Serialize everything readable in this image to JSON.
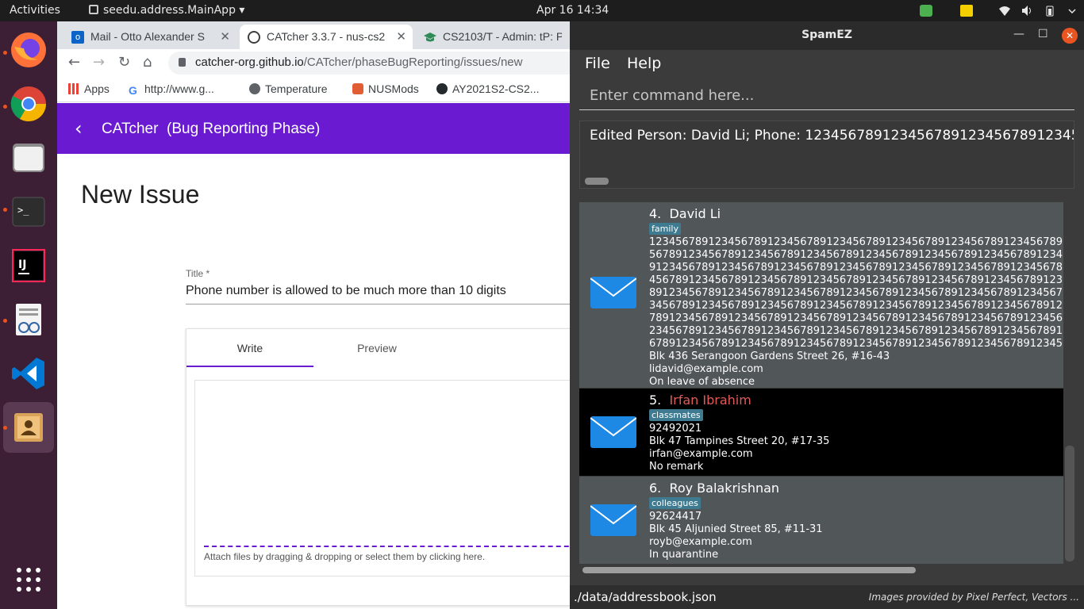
{
  "topbar": {
    "activities": "Activities",
    "app_menu": "seedu.address.MainApp",
    "clock": "Apr 16  14:34"
  },
  "browser": {
    "tabs": [
      {
        "label": "Mail - Otto Alexander S",
        "active": false
      },
      {
        "label": "CATcher 3.3.7 - nus-cs2",
        "active": true
      },
      {
        "label": "CS2103/T - Admin: tP: P",
        "active": false
      }
    ],
    "url_host": "catcher-org.github.io",
    "url_path": "/CATcher/phaseBugReporting/issues/new",
    "bookmarks": [
      "Apps",
      "http://www.g...",
      "Temperature",
      "NUSMods",
      "AY2021S2-CS2..."
    ],
    "app_title": "CATcher  (Bug Reporting Phase)",
    "page_heading": "New Issue",
    "title_label": "Title *",
    "title_value": "Phone number is allowed to be much more than 10 digits",
    "editor_tabs": [
      "Write",
      "Preview"
    ],
    "attach_hint": "Attach files by dragging & dropping or select them by clicking here."
  },
  "spamez": {
    "window_title": "SpamEZ",
    "menu": [
      "File",
      "Help"
    ],
    "command_placeholder": "Enter command here...",
    "result": "Edited Person: David Li; Phone: 123456789123456789123456789123456789",
    "persons": [
      {
        "index": "4.",
        "name": "David Li",
        "tag": "family",
        "phone_lines": [
          "123456789123456789123456789123456789123456789123456789123456789",
          "567891234567891234567891234567891234567891234567891234567891234",
          "912345678912345678912345678912345678912345678912345678912345678",
          "456789123456789123456789123456789123456789123456789123456789123",
          "891234567891234567891234567891234567891234567891234567891234567",
          "345678912345678912345678912345678912345678912345678912345678912",
          "789123456789123456789123456789123456789123456789123456789123456",
          "234567891234567891234567891234567891234567891234567891234567891",
          "678912345678912345678912345678912345678912345678912345678912345"
        ],
        "address": "Blk 436 Serangoon Gardens Street 26, #16-43",
        "email": "lidavid@example.com",
        "remark": "On leave of absence",
        "selected": false
      },
      {
        "index": "5.",
        "name": "Irfan Ibrahim",
        "tag": "classmates",
        "phone_lines": [
          "92492021"
        ],
        "address": "Blk 47 Tampines Street 20, #17-35",
        "email": "irfan@example.com",
        "remark": "No remark",
        "selected": true
      },
      {
        "index": "6.",
        "name": "Roy Balakrishnan",
        "tag": "colleagues",
        "phone_lines": [
          "92624417"
        ],
        "address": "Blk 45 Aljunied Street 85, #11-31",
        "email": "royb@example.com",
        "remark": "In quarantine",
        "selected": false
      }
    ],
    "status_path": "./data/addressbook.json",
    "status_credit": "Images provided by Pixel Perfect, Vectors ..."
  },
  "colors": {
    "catcher_purple": "#6a1bd1",
    "ubuntu_orange": "#e95420",
    "dock_bg": "#3c1f35",
    "tag_bg": "#3e7b91",
    "selected_name": "#e05a5a",
    "envelope_blue": "#1e88e5"
  }
}
